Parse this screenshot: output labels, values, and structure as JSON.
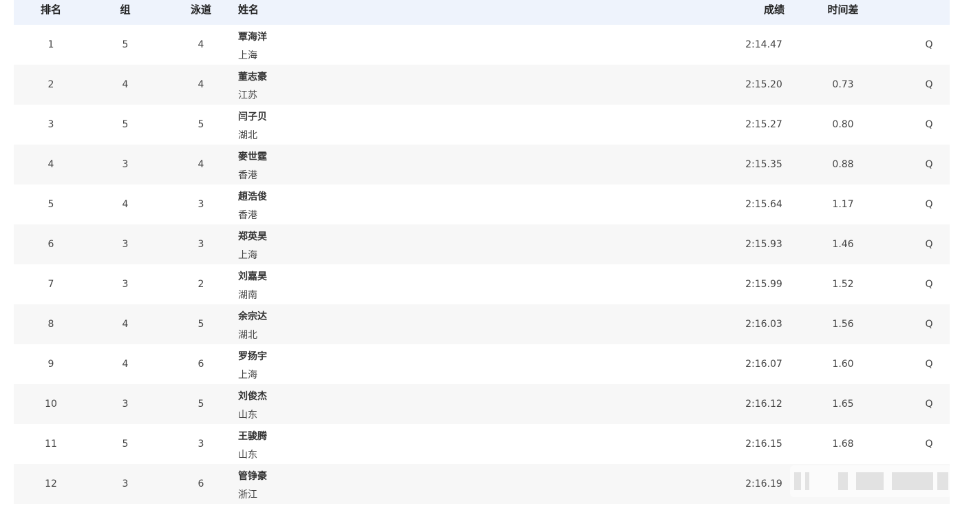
{
  "header": {
    "rank": "排名",
    "heat": "组",
    "lane": "泳道",
    "name": "姓名",
    "result": "成绩",
    "diff": "时间差"
  },
  "rows": [
    {
      "rank": "1",
      "heat": "5",
      "lane": "4",
      "name": "覃海洋",
      "team": "上海",
      "result": "2:14.47",
      "diff": "",
      "qual": "Q"
    },
    {
      "rank": "2",
      "heat": "4",
      "lane": "4",
      "name": "董志豪",
      "team": "江苏",
      "result": "2:15.20",
      "diff": "0.73",
      "qual": "Q"
    },
    {
      "rank": "3",
      "heat": "5",
      "lane": "5",
      "name": "闫子贝",
      "team": "湖北",
      "result": "2:15.27",
      "diff": "0.80",
      "qual": "Q"
    },
    {
      "rank": "4",
      "heat": "3",
      "lane": "4",
      "name": "麥世霆",
      "team": "香港",
      "result": "2:15.35",
      "diff": "0.88",
      "qual": "Q"
    },
    {
      "rank": "5",
      "heat": "4",
      "lane": "3",
      "name": "趙浩俊",
      "team": "香港",
      "result": "2:15.64",
      "diff": "1.17",
      "qual": "Q"
    },
    {
      "rank": "6",
      "heat": "3",
      "lane": "3",
      "name": "郑英昊",
      "team": "上海",
      "result": "2:15.93",
      "diff": "1.46",
      "qual": "Q"
    },
    {
      "rank": "7",
      "heat": "3",
      "lane": "2",
      "name": "刘嘉昊",
      "team": "湖南",
      "result": "2:15.99",
      "diff": "1.52",
      "qual": "Q"
    },
    {
      "rank": "8",
      "heat": "4",
      "lane": "5",
      "name": "余宗达",
      "team": "湖北",
      "result": "2:16.03",
      "diff": "1.56",
      "qual": "Q"
    },
    {
      "rank": "9",
      "heat": "4",
      "lane": "6",
      "name": "罗扬宇",
      "team": "上海",
      "result": "2:16.07",
      "diff": "1.60",
      "qual": "Q"
    },
    {
      "rank": "10",
      "heat": "3",
      "lane": "5",
      "name": "刘俊杰",
      "team": "山东",
      "result": "2:16.12",
      "diff": "1.65",
      "qual": "Q"
    },
    {
      "rank": "11",
      "heat": "5",
      "lane": "3",
      "name": "王骏腾",
      "team": "山东",
      "result": "2:16.15",
      "diff": "1.68",
      "qual": "Q"
    },
    {
      "rank": "12",
      "heat": "3",
      "lane": "6",
      "name": "管铮豪",
      "team": "浙江",
      "result": "2:16.19",
      "diff": "",
      "qual": ""
    }
  ],
  "colors": {
    "header_bg": "#eef3fc",
    "row_alt_bg": "#f7f7f7"
  }
}
